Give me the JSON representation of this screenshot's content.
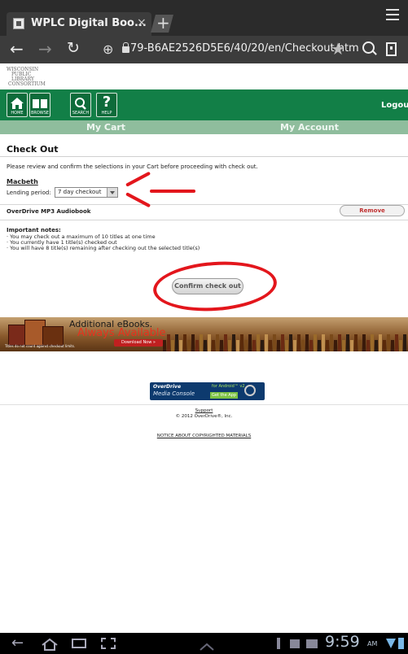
{
  "browser": {
    "tab_title": "WPLC Digital Boo...",
    "tab_close": "×",
    "new_tab": "+",
    "url": "79-B6AE2526D5E6/40/20/en/Checkout.htm"
  },
  "site": {
    "logo_lines": [
      "WISCONSIN",
      "PUBLIC",
      "LIBRARY",
      "CONSORTIUM"
    ],
    "nav": [
      {
        "label": "HOME",
        "icon": "house-icon"
      },
      {
        "label": "BROWSE",
        "icon": "book-icon"
      },
      {
        "label": "SEARCH",
        "icon": "magnifier-icon"
      },
      {
        "label": "HELP",
        "icon": "question-icon"
      }
    ],
    "logout": "Logout",
    "tabs": {
      "my_cart": "My Cart",
      "my_account": "My Account"
    }
  },
  "checkout": {
    "title": "Check Out",
    "instructions": "Please review and confirm the selections in your Cart before proceeding with check out.",
    "item": {
      "title": "Macbeth",
      "lending_label": "Lending period:",
      "lending_value": "7 day checkout",
      "format": "OverDrive MP3 Audiobook",
      "remove_label": "Remove"
    },
    "notes_heading": "Important notes:",
    "notes": [
      "· You may check out a maximum of 10 titles at one time",
      "· You currently have 1 title(s) checked out",
      "· You will have 8 title(s) remaining after checking out the selected title(s)"
    ],
    "confirm_label": "Confirm check out"
  },
  "banner": {
    "line1": "Additional eBooks.",
    "line2": "Always Available",
    "button": "Download Now »",
    "note": "Titles do not count against checkout limits."
  },
  "footer": {
    "odmc_brand": "OverDrive",
    "odmc_sub": "Media Console",
    "odmc_android": "for Android™ v2",
    "odmc_app": "Get the App",
    "support": "Support",
    "copyright": "© 2012 OverDrive®, Inc.",
    "notice": "NOTICE ABOUT COPYRIGHTED MATERIALS"
  },
  "system": {
    "time": "9:59",
    "ampm": "AM"
  },
  "annotation_color": "#e3161c"
}
